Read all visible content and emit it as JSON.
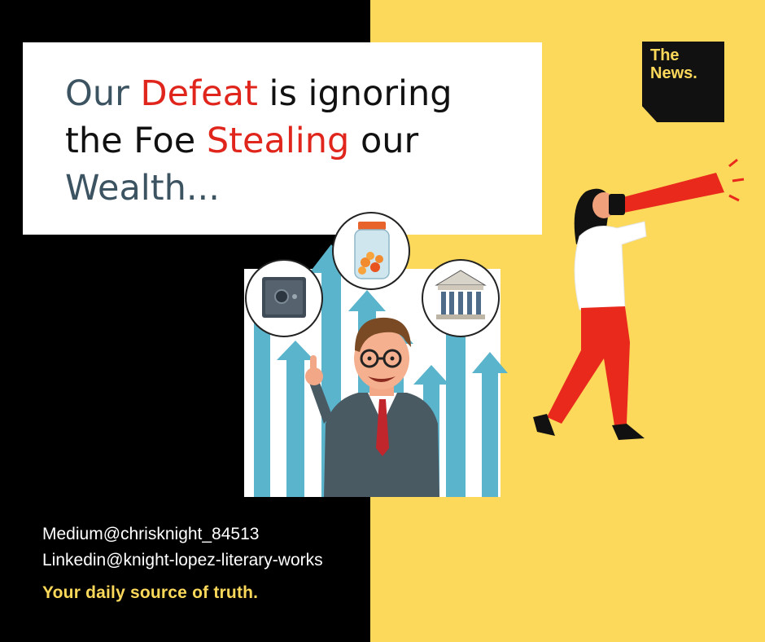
{
  "brand": {
    "line1": "The",
    "line2": "News."
  },
  "headline": {
    "w1": "Our",
    "w2": "Defeat",
    "w3": "is ignoring",
    "w4": "the Foe",
    "w5": "Stealing",
    "w6": "our",
    "w7": "Wealth..."
  },
  "credits": {
    "medium": "Medium@chrisknight_84513",
    "linkedin": "Linkedin@knight-lopez-literary-works"
  },
  "tagline": "Your daily source of truth.",
  "icons": [
    "safe-icon",
    "coin-jar-icon",
    "bank-icon",
    "rising-arrows-icon",
    "businessman-illustration",
    "woman-with-megaphone-illustration"
  ],
  "colors": {
    "yellow": "#fcd95a",
    "red": "#e0261c",
    "slate": "#3c5361",
    "arrow_blue": "#5ab4cc"
  }
}
